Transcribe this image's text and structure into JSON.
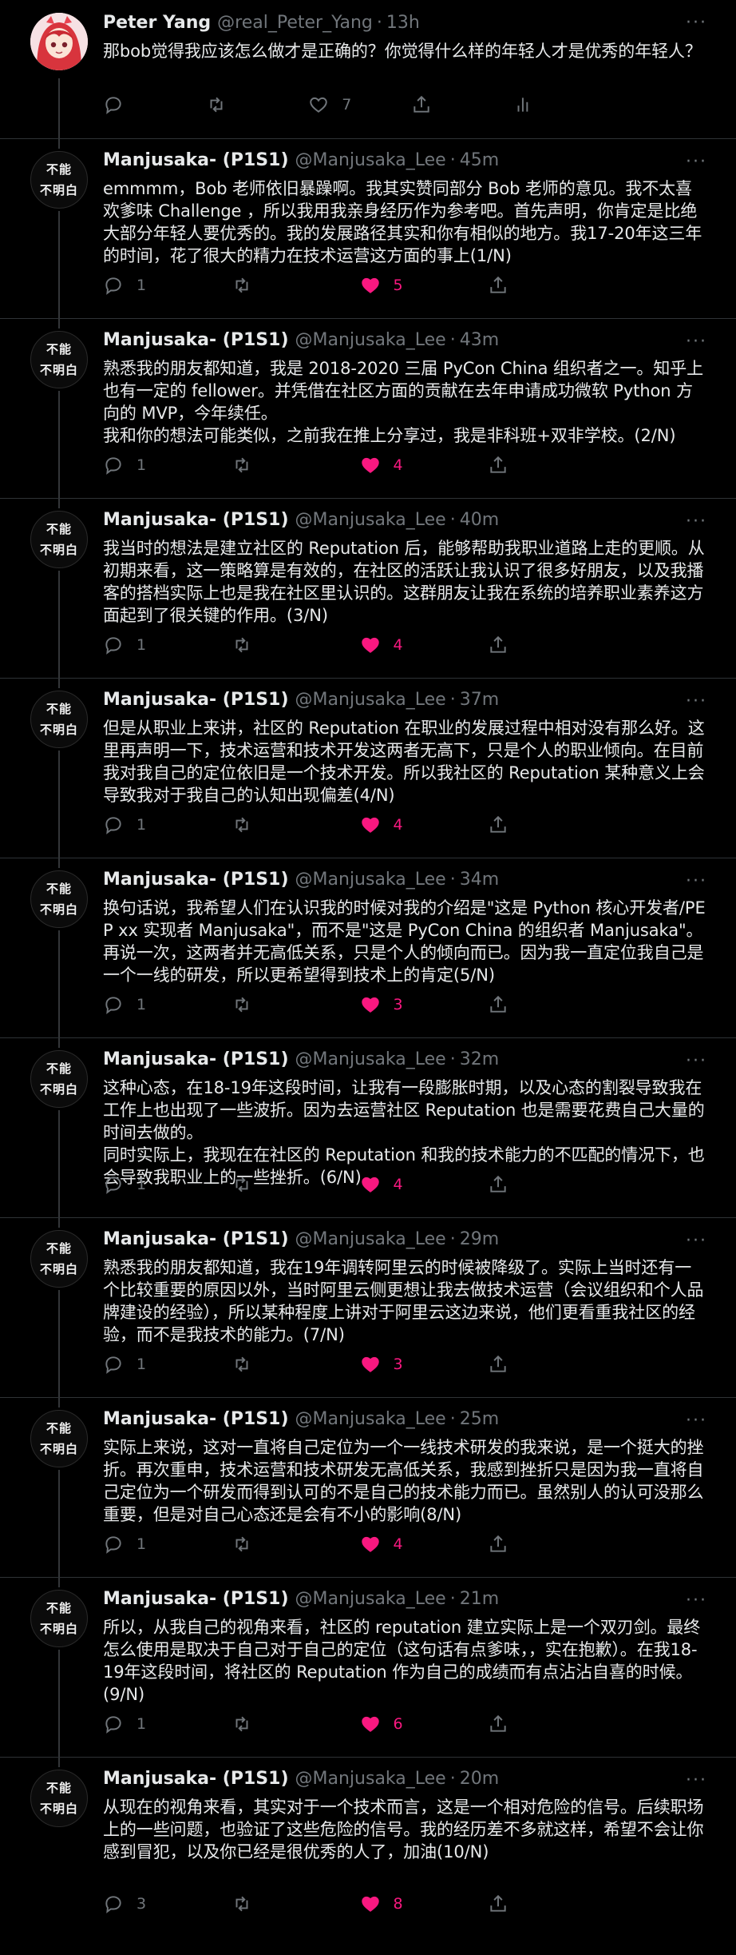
{
  "colors": {
    "background": "#000000",
    "text": "#e7e9ea",
    "muted": "#71767b",
    "like": "#f91880",
    "divider": "#2f3336"
  },
  "first": {
    "name": "Peter Yang",
    "handle": "@real_Peter_Yang",
    "time": "13h",
    "text": "那bob觉得我应该怎么做才是正确的？你觉得什么样的年轻人才是优秀的年轻人？",
    "likes": "7",
    "icons": [
      "reply-icon",
      "retweet-icon",
      "heart-icon",
      "share-icon",
      "analytics-icon"
    ]
  },
  "replies": [
    {
      "name": "Manjusaka- (P1S1)",
      "handle": "@Manjusaka_Lee",
      "time": "45m",
      "avatar_top": "不能",
      "avatar_bottom": "不明白",
      "text": "emmmm，Bob 老师依旧暴躁啊。我其实赞同部分 Bob 老师的意见。我不太喜欢爹味 Challenge ，所以我用我亲身经历作为参考吧。首先声明，你肯定是比绝大部分年轻人要优秀的。我的发展路径其实和你有相似的地方。我17-20年这三年的时间，花了很大的精力在技术运营这方面的事上(1/N)",
      "replies_count": "1",
      "likes": "5"
    },
    {
      "name": "Manjusaka- (P1S1)",
      "handle": "@Manjusaka_Lee",
      "time": "43m",
      "avatar_top": "不能",
      "avatar_bottom": "不明白",
      "text": "熟悉我的朋友都知道，我是 2018-2020 三届 PyCon China 组织者之一。知乎上也有一定的 fellower。并凭借在社区方面的贡献在去年申请成功微软 Python 方向的 MVP，今年续任。\n我和你的想法可能类似，之前我在推上分享过，我是非科班+双非学校。(2/N)",
      "replies_count": "1",
      "likes": "4"
    },
    {
      "name": "Manjusaka- (P1S1)",
      "handle": "@Manjusaka_Lee",
      "time": "40m",
      "avatar_top": "不能",
      "avatar_bottom": "不明白",
      "text": "我当时的想法是建立社区的 Reputation 后，能够帮助我职业道路上走的更顺。从初期来看，这一策略算是有效的，在社区的活跃让我认识了很多好朋友，以及我播客的搭档实际上也是我在社区里认识的。这群朋友让我在系统的培养职业素养这方面起到了很关键的作用。(3/N)",
      "replies_count": "1",
      "likes": "4"
    },
    {
      "name": "Manjusaka- (P1S1)",
      "handle": "@Manjusaka_Lee",
      "time": "37m",
      "avatar_top": "不能",
      "avatar_bottom": "不明白",
      "text": "但是从职业上来讲，社区的 Reputation 在职业的发展过程中相对没有那么好。这里再声明一下，技术运营和技术开发这两者无高下，只是个人的职业倾向。在目前我对我自己的定位依旧是一个技术开发。所以我社区的 Reputation 某种意义上会导致我对于我自己的认知出现偏差(4/N)",
      "replies_count": "1",
      "likes": "4"
    },
    {
      "name": "Manjusaka- (P1S1)",
      "handle": "@Manjusaka_Lee",
      "time": "34m",
      "avatar_top": "不能",
      "avatar_bottom": "不明白",
      "text": "换句话说，我希望人们在认识我的时候对我的介绍是\"这是 Python 核心开发者/PEP xx 实现者 Manjusaka\"，而不是\"这是 PyCon China 的组织者 Manjusaka\"。再说一次，这两者并无高低关系，只是个人的倾向而已。因为我一直定位我自己是一个一线的研发，所以更希望得到技术上的肯定(5/N)",
      "replies_count": "1",
      "likes": "3"
    },
    {
      "name": "Manjusaka- (P1S1)",
      "handle": "@Manjusaka_Lee",
      "time": "32m",
      "avatar_top": "不能",
      "avatar_bottom": "不明白",
      "text": "这种心态，在18-19年这段时间，让我有一段膨胀时期，以及心态的割裂导致我在工作上也出现了一些波折。因为去运营社区 Reputation 也是需要花费自己大量的时间去做的。\n同时实际上，我现在在社区的 Reputation 和我的技术能力的不匹配的情况下，也会导致我职业上的一些挫折。(6/N)",
      "replies_count": "1",
      "likes": "4"
    },
    {
      "name": "Manjusaka- (P1S1)",
      "handle": "@Manjusaka_Lee",
      "time": "29m",
      "avatar_top": "不能",
      "avatar_bottom": "不明白",
      "text": "熟悉我的朋友都知道，我在19年调转阿里云的时候被降级了。实际上当时还有一个比较重要的原因以外，当时阿里云侧更想让我去做技术运营（会议组织和个人品牌建设的经验），所以某种程度上讲对于阿里云这边来说，他们更看重我社区的经验，而不是我技术的能力。(7/N)",
      "replies_count": "1",
      "likes": "3"
    },
    {
      "name": "Manjusaka- (P1S1)",
      "handle": "@Manjusaka_Lee",
      "time": "25m",
      "avatar_top": "不能",
      "avatar_bottom": "不明白",
      "text": "实际上来说，这对一直将自己定位为一个一线技术研发的我来说，是一个挺大的挫折。再次重申，技术运营和技术研发无高低关系，我感到挫折只是因为我一直将自己定位为一个研发而得到认可的不是自己的技术能力而已。虽然别人的认可没那么重要，但是对自己心态还是会有不小的影响(8/N)",
      "replies_count": "1",
      "likes": "4"
    },
    {
      "name": "Manjusaka- (P1S1)",
      "handle": "@Manjusaka_Lee",
      "time": "21m",
      "avatar_top": "不能",
      "avatar_bottom": "不明白",
      "text": "所以，从我自己的视角来看，社区的 reputation 建立实际上是一个双刃剑。最终怎么使用是取决于自己对于自己的定位（这句话有点爹味，，实在抱歉）。在我18-19年这段时间，将社区的 Reputation 作为自己的成绩而有点沾沾自喜的时候。(9/N)",
      "replies_count": "1",
      "likes": "6"
    },
    {
      "name": "Manjusaka- (P1S1)",
      "handle": "@Manjusaka_Lee",
      "time": "20m",
      "avatar_top": "不能",
      "avatar_bottom": "不明白",
      "text": "从现在的视角来看，其实对于一个技术而言，这是一个相对危险的信号。后续职场上的一些问题，也验证了这些危险的信号。我的经历差不多就这样，希望不会让你感到冒犯，以及你已经是很优秀的人了，加油(10/N)",
      "replies_count": "3",
      "likes": "8"
    }
  ]
}
